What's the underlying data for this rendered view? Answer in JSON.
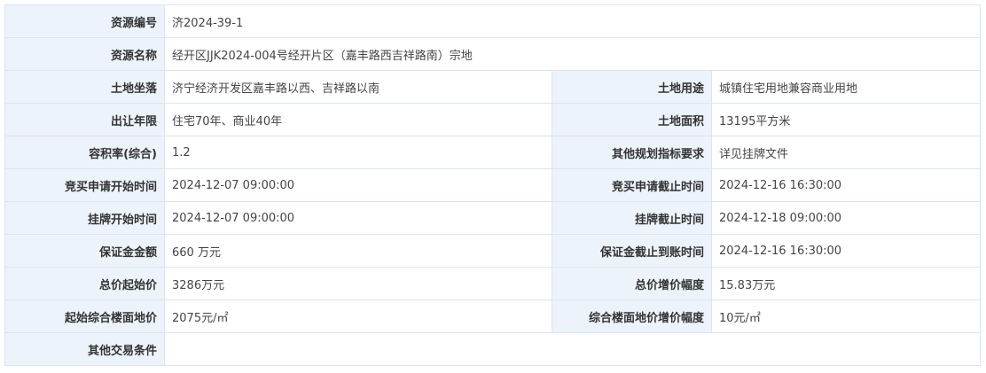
{
  "rows": [
    {
      "label": "资源编号",
      "value": "济2024-39-1"
    },
    {
      "label": "资源名称",
      "value": "经开区JJK2024-004号经开片区（嘉丰路西吉祥路南）宗地"
    },
    {
      "label": "土地坐落",
      "value": "济宁经济开发区嘉丰路以西、吉祥路以南",
      "label2": "土地用途",
      "value2": "城镇住宅用地兼容商业用地"
    },
    {
      "label": "出让年限",
      "value": "住宅70年、商业40年",
      "label2": "土地面积",
      "value2": "13195平方米"
    },
    {
      "label": "容积率(综合)",
      "value": "1.2",
      "label2": "其他规划指标要求",
      "value2": "详见挂牌文件"
    },
    {
      "label": "竞买申请开始时间",
      "value": "2024-12-07 09:00:00",
      "label2": "竞买申请截止时间",
      "value2": "2024-12-16 16:30:00"
    },
    {
      "label": "挂牌开始时间",
      "value": "2024-12-07 09:00:00",
      "label2": "挂牌截止时间",
      "value2": "2024-12-18 09:00:00"
    },
    {
      "label": "保证金金额",
      "value": "660 万元",
      "label2": "保证金截止到账时间",
      "value2": "2024-12-16 16:30:00"
    },
    {
      "label": "总价起始价",
      "value": "3286万元",
      "label2": "总价增价幅度",
      "value2": "15.83万元"
    },
    {
      "label": "起始综合楼面地价",
      "value": "2075元/㎡",
      "label2": "综合楼面地价增价幅度",
      "value2": "10元/㎡"
    },
    {
      "label": "其他交易条件",
      "value": ""
    }
  ]
}
